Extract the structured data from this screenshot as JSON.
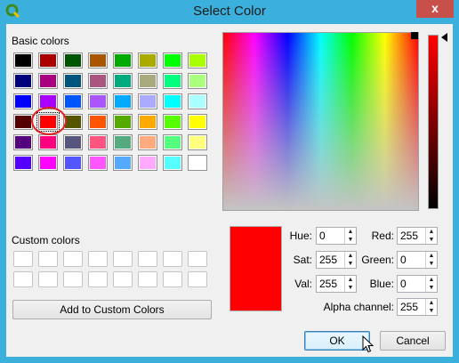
{
  "window": {
    "title": "Select Color",
    "close_glyph": "x",
    "app_icon": "qgis-icon"
  },
  "basic_colors": {
    "label": "Basic colors",
    "rows": [
      [
        "#000000",
        "#aa0000",
        "#005500",
        "#aa5500",
        "#00aa00",
        "#aaaa00",
        "#00ff00",
        "#aaff00"
      ],
      [
        "#00007f",
        "#aa007f",
        "#00557f",
        "#aa557f",
        "#00aa7f",
        "#aaaa7f",
        "#00ff7f",
        "#aaff7f"
      ],
      [
        "#0000ff",
        "#aa00ff",
        "#0055ff",
        "#aa55ff",
        "#00aaff",
        "#aaaaff",
        "#00ffff",
        "#aaffff"
      ],
      [
        "#550000",
        "#ff0000",
        "#555500",
        "#ff5500",
        "#55aa00",
        "#ffaa00",
        "#55ff00",
        "#ffff00"
      ],
      [
        "#55007f",
        "#ff007f",
        "#55557f",
        "#ff557f",
        "#55aa7f",
        "#ffaa7f",
        "#55ff7f",
        "#ffff7f"
      ],
      [
        "#5500ff",
        "#ff00ff",
        "#5555ff",
        "#ff55ff",
        "#55aaff",
        "#ffaaff",
        "#55ffff",
        "#ffffff"
      ]
    ],
    "selected": {
      "row": 3,
      "col": 1
    }
  },
  "custom_colors": {
    "label": "Custom colors",
    "add_button": "Add to Custom Colors",
    "count": 16
  },
  "fields": {
    "hue": {
      "label": "Hue:",
      "value": "0"
    },
    "sat": {
      "label": "Sat:",
      "value": "255"
    },
    "val": {
      "label": "Val:",
      "value": "255"
    },
    "red": {
      "label": "Red:",
      "value": "255"
    },
    "green": {
      "label": "Green:",
      "value": "0"
    },
    "blue": {
      "label": "Blue:",
      "value": "0"
    },
    "alpha": {
      "label": "Alpha channel:",
      "value": "255"
    }
  },
  "current_color": "#ff0000",
  "buttons": {
    "ok": "OK",
    "cancel": "Cancel"
  }
}
